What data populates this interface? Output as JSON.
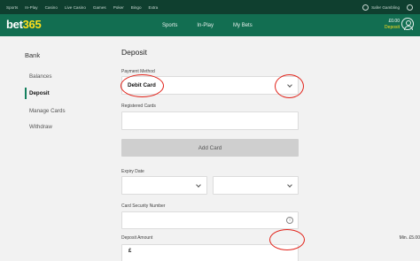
{
  "topbar": {
    "links": [
      "Sports",
      "In-Play",
      "Casino",
      "Live Casino",
      "Games",
      "Poker",
      "Bingo",
      "Extra"
    ],
    "safer_gambling": "Safer Gambling"
  },
  "header": {
    "logo_bet": "bet",
    "logo_365": "365",
    "nav": [
      "Sports",
      "In-Play",
      "My Bets"
    ],
    "balance": "£0.00",
    "deposit": "Deposit"
  },
  "sidebar": {
    "title": "Bank",
    "items": [
      {
        "label": "Balances",
        "active": false
      },
      {
        "label": "Deposit",
        "active": true
      },
      {
        "label": "Manage Cards",
        "active": false
      },
      {
        "label": "Withdraw",
        "active": false
      }
    ]
  },
  "deposit": {
    "title": "Deposit",
    "payment_method_label": "Payment Method",
    "payment_method_value": "Debit Card",
    "registered_cards_label": "Registered Cards",
    "add_card_label": "Add Card",
    "expiry_label": "Expiry Date",
    "security_label": "Card Security Number",
    "info_glyph": "i",
    "amount_label": "Deposit Amount",
    "min_label": "Min. £5.00",
    "currency_symbol": "£"
  },
  "colors": {
    "topbar": "#0f3f2f",
    "header": "#126e51",
    "brand_yellow": "#ffdf1b",
    "annotation_red": "#e2231a"
  },
  "icons": [
    "info-icon",
    "user-avatar-icon",
    "chevron-down-icon"
  ]
}
